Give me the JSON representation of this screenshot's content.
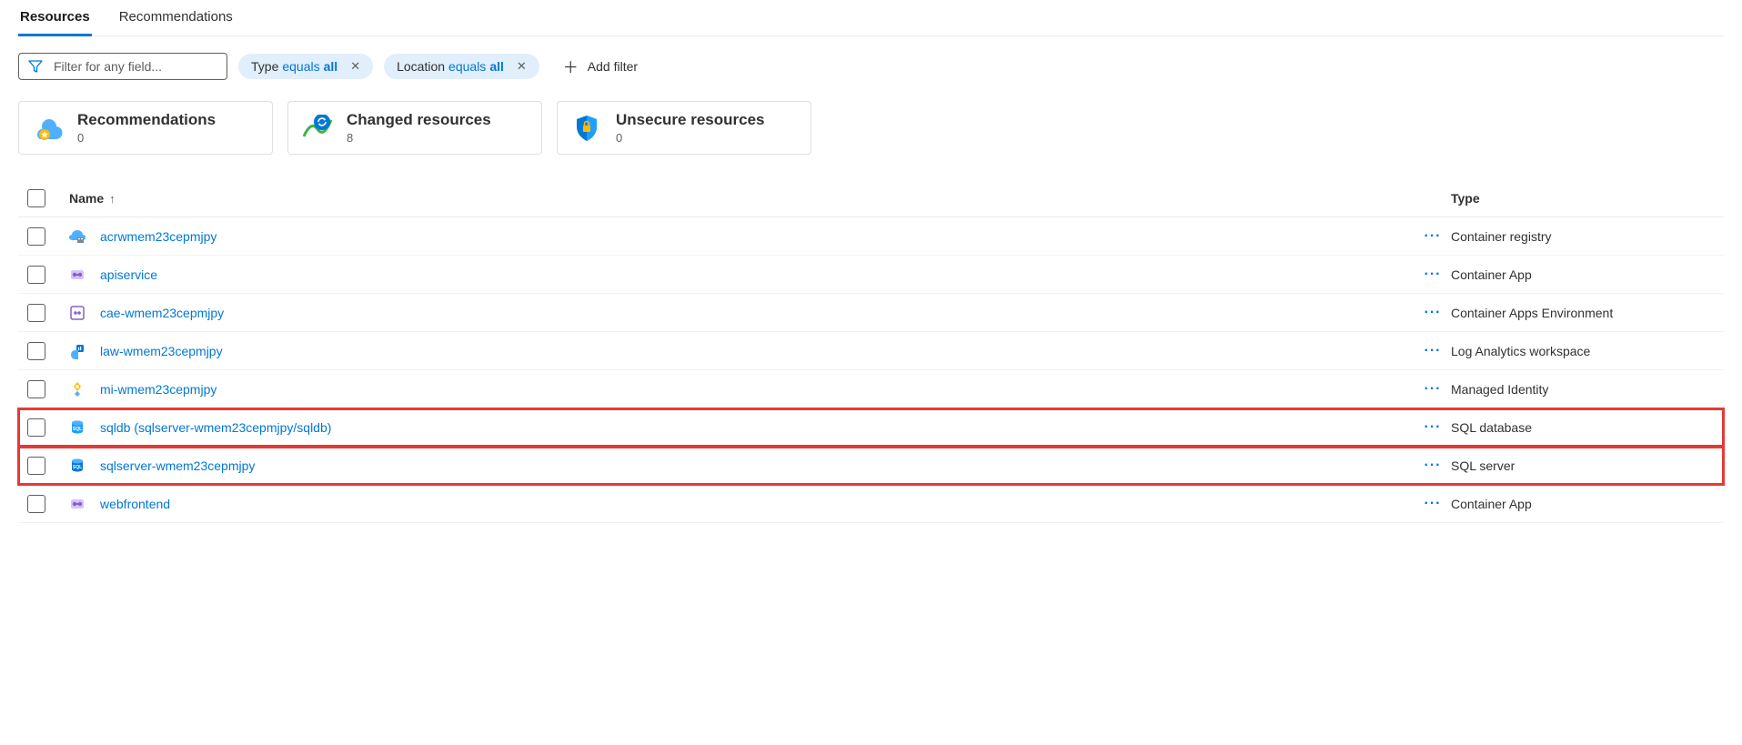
{
  "tabs": {
    "resources": "Resources",
    "recommendations": "Recommendations"
  },
  "filters": {
    "placeholder": "Filter for any field...",
    "type_pill_prefix": "Type ",
    "type_pill_op": "equals ",
    "type_pill_val": "all",
    "loc_pill_prefix": "Location ",
    "loc_pill_op": "equals ",
    "loc_pill_val": "all",
    "add_filter": "Add filter"
  },
  "cards": {
    "recommendations": {
      "title": "Recommendations",
      "count": "0"
    },
    "changed": {
      "title": "Changed resources",
      "count": "8"
    },
    "unsecure": {
      "title": "Unsecure resources",
      "count": "0"
    }
  },
  "table": {
    "headers": {
      "name": "Name",
      "type": "Type"
    },
    "rows": [
      {
        "name": "acrwmem23cepmjpy",
        "type": "Container registry",
        "icon": "registry",
        "hl": false
      },
      {
        "name": "apiservice",
        "type": "Container App",
        "icon": "containerapp",
        "hl": false
      },
      {
        "name": "cae-wmem23cepmjpy",
        "type": "Container Apps Environment",
        "icon": "caenv",
        "hl": false
      },
      {
        "name": "law-wmem23cepmjpy",
        "type": "Log Analytics workspace",
        "icon": "law",
        "hl": false
      },
      {
        "name": "mi-wmem23cepmjpy",
        "type": "Managed Identity",
        "icon": "mi",
        "hl": false
      },
      {
        "name": "sqldb (sqlserver-wmem23cepmjpy/sqldb)",
        "type": "SQL database",
        "icon": "sqldb",
        "hl": true
      },
      {
        "name": "sqlserver-wmem23cepmjpy",
        "type": "SQL server",
        "icon": "sqlsrv",
        "hl": true
      },
      {
        "name": "webfrontend",
        "type": "Container App",
        "icon": "containerapp",
        "hl": false
      }
    ]
  }
}
